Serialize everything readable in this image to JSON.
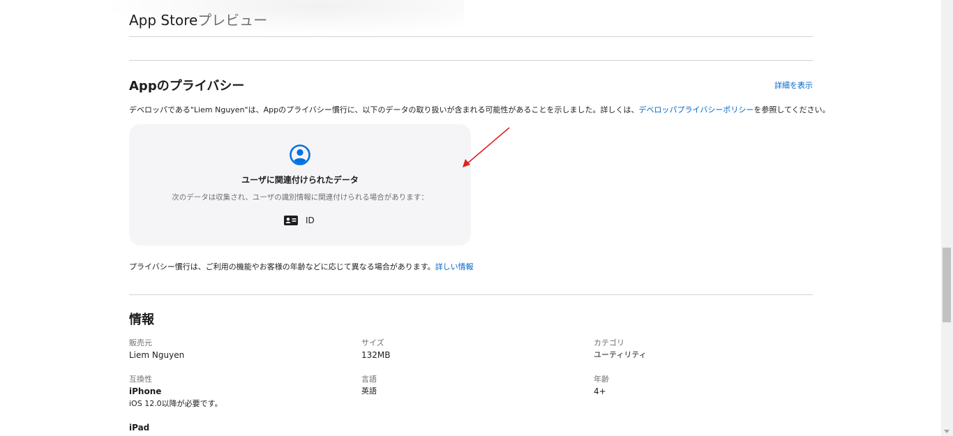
{
  "preview": {
    "title_main": "App Store",
    "title_sub": "プレビュー"
  },
  "privacy": {
    "title": "Appのプライバシー",
    "see_details": "詳細を表示",
    "desc_prefix": "デベロッパである\"Liem Nguyen\"は、Appのプライバシー慣行に、以下のデータの取り扱いが含まれる可能性があることを示しました。詳しくは、",
    "desc_link": "デベロッパプライバシーポリシー",
    "desc_suffix": "を参照してください。",
    "card": {
      "title": "ユーザに関連付けられたデータ",
      "subtitle": "次のデータは収集され、ユーザの識別情報に関連付けられる場合があります：",
      "item_label": "ID",
      "icon": "user-circle-icon",
      "item_icon": "id-card-icon"
    },
    "note_text": "プライバシー慣行は、ご利用の機能やお客様の年齢などに応じて異なる場合があります。",
    "note_link": "詳しい情報"
  },
  "info": {
    "title": "情報",
    "seller_label": "販売元",
    "seller_value": "Liem Nguyen",
    "size_label": "サイズ",
    "size_value": "132MB",
    "category_label": "カテゴリ",
    "category_value": "ユーティリティ",
    "compat_label": "互換性",
    "compat_device1": "iPhone",
    "compat_req1": "iOS 12.0以降が必要です。",
    "compat_device2": "iPad",
    "language_label": "言語",
    "language_value": "英語",
    "age_label": "年齢",
    "age_value": "4+"
  },
  "colors": {
    "link": "#0066cc",
    "card_bg": "#f5f5f7",
    "arrow": "#e02020"
  }
}
